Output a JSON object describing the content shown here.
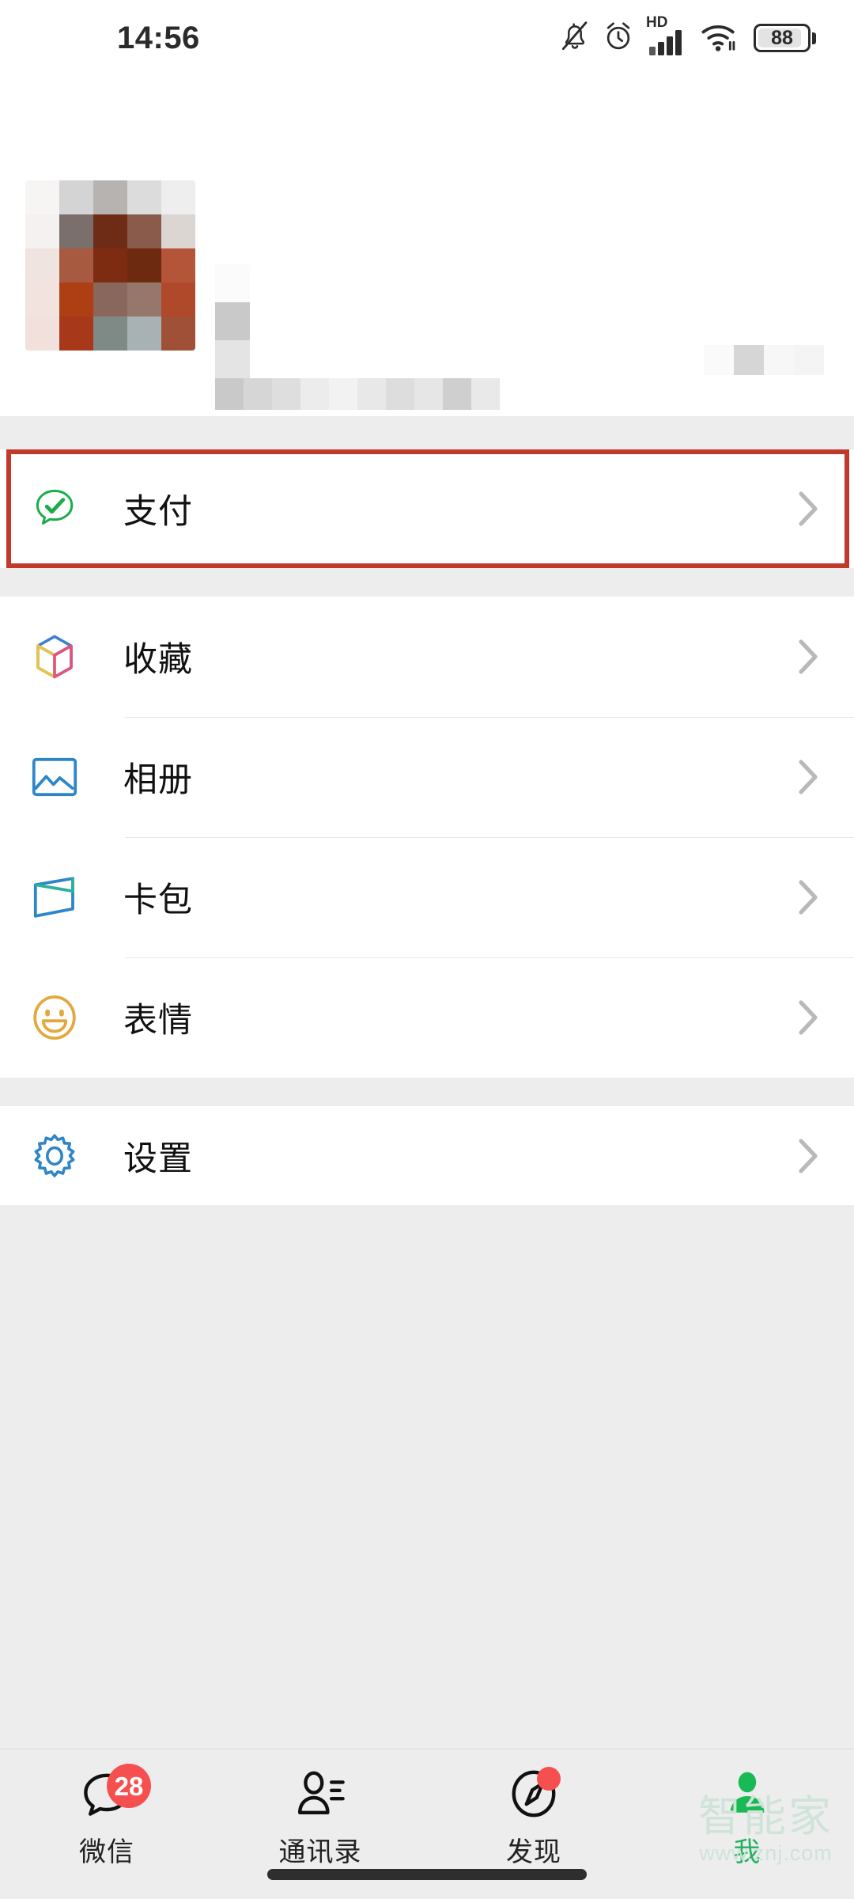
{
  "status_bar": {
    "time": "14:56",
    "battery_level": "88",
    "network_label": "HD",
    "icons": [
      "mute-bell-icon",
      "alarm-clock-icon",
      "hd-signal-icon",
      "wifi-icon",
      "battery-icon"
    ]
  },
  "header": {
    "camera_icon": "camera-icon"
  },
  "profile": {
    "redacted": true,
    "avatar_icon": "avatar-mosaic",
    "name_redacted": "",
    "wechat_id_redacted": "",
    "qr_redacted": "",
    "avatar_blocks": [
      "#f7f5f4",
      "#d4d4d4",
      "#b6b3b0",
      "#dcdcdc",
      "#eeeeee",
      "#f4f1f0",
      "#7a6f6a",
      "#6e2c17",
      "#8a5a4b",
      "#dcd6d3",
      "#efe4e0",
      "#a85a40",
      "#7d2c12",
      "#6d2a11",
      "#b4553a",
      "#f2e3de",
      "#ae3f15",
      "#8a675c",
      "#97766b",
      "#b0482a",
      "#f1e0db",
      "#a8381a",
      "#7f8a86",
      "#a8b2b4",
      "#a05036"
    ],
    "name_blocks": [
      "#fbfbfb",
      "#c9c9c9",
      "#e4e4e4"
    ],
    "id_blocks": [
      "#c9c9c9",
      "#d6d6d6",
      "#dedede",
      "#ececec",
      "#f2f2f2",
      "#e8e8e8",
      "#dddddd",
      "#e6e6e6",
      "#cfcfcf",
      "#e9e9e9"
    ],
    "right_blocks": [
      "#fafafa",
      "#d6d6d6",
      "#f7f7f7",
      "#f4f4f4"
    ]
  },
  "sections": [
    {
      "id": "pay-section",
      "highlighted": true,
      "rows": [
        {
          "id": "pay",
          "label": "支付",
          "icon": "pay-icon",
          "icon_color": "#1aad4b"
        }
      ]
    },
    {
      "id": "content-section",
      "highlighted": false,
      "rows": [
        {
          "id": "favorites",
          "label": "收藏",
          "icon": "favorites-cube-icon",
          "icon_color": "#3c7fd4"
        },
        {
          "id": "album",
          "label": "相册",
          "icon": "album-photo-icon",
          "icon_color": "#2e86c8"
        },
        {
          "id": "cards",
          "label": "卡包",
          "icon": "cards-wallet-icon",
          "icon_color": "#2e86c8"
        },
        {
          "id": "stickers",
          "label": "表情",
          "icon": "stickers-smiley-icon",
          "icon_color": "#e2a93e"
        }
      ]
    },
    {
      "id": "settings-section",
      "highlighted": false,
      "rows": [
        {
          "id": "settings",
          "label": "设置",
          "icon": "settings-gear-icon",
          "icon_color": "#2e86c8"
        }
      ]
    }
  ],
  "annotation": {
    "target": "pay",
    "color": "#c0392b"
  },
  "tabbar": {
    "active_index": 3,
    "active_color": "#22b160",
    "badge_color": "#f5504f",
    "tabs": [
      {
        "id": "chats",
        "label": "微信",
        "icon": "chat-bubble-icon",
        "badge": "28",
        "dot": false
      },
      {
        "id": "contacts",
        "label": "通讯录",
        "icon": "contacts-icon",
        "badge": null,
        "dot": false
      },
      {
        "id": "discover",
        "label": "发现",
        "icon": "compass-icon",
        "badge": null,
        "dot": true
      },
      {
        "id": "me",
        "label": "我",
        "icon": "person-icon",
        "badge": null,
        "dot": false
      }
    ]
  },
  "watermark": {
    "text_cn": "智能家",
    "text_url": "www.znj.com"
  }
}
